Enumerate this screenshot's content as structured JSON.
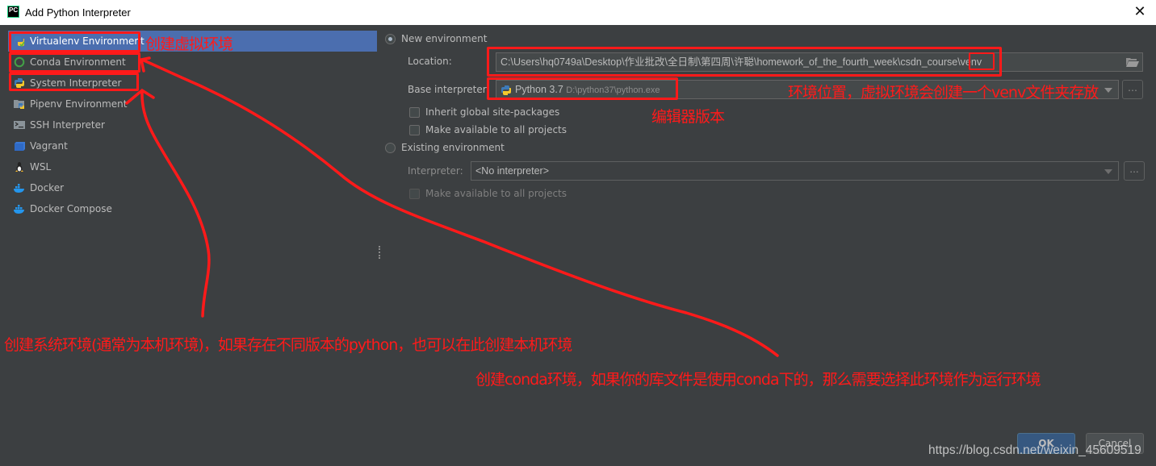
{
  "window": {
    "app_icon": "PC",
    "title": "Add Python Interpreter",
    "close_icon": "close-icon"
  },
  "sidebar": {
    "items": [
      {
        "label": "Virtualenv Environment",
        "icon": "virtualenv-icon",
        "selected": true
      },
      {
        "label": "Conda Environment",
        "icon": "conda-icon"
      },
      {
        "label": "System Interpreter",
        "icon": "python-icon"
      },
      {
        "label": "Pipenv Environment",
        "icon": "pipenv-icon"
      },
      {
        "label": "SSH Interpreter",
        "icon": "terminal-icon"
      },
      {
        "label": "Vagrant",
        "icon": "vagrant-icon"
      },
      {
        "label": "WSL",
        "icon": "linux-icon"
      },
      {
        "label": "Docker",
        "icon": "docker-icon"
      },
      {
        "label": "Docker Compose",
        "icon": "docker-compose-icon"
      }
    ]
  },
  "main": {
    "new_env": {
      "label": "New environment",
      "selected": true,
      "location_label": "Location:",
      "location_value": "C:\\Users\\hq0749a\\Desktop\\作业批改\\全日制\\第四周\\许聪\\homework_of_the_fourth_week\\csdn_course\\venv",
      "base_label": "Base interpreter:",
      "base_version": "Python 3.7",
      "base_path": "D:\\python37\\python.exe",
      "inherit_label": "Inherit global site-packages",
      "inherit_checked": false,
      "available_label": "Make available to all projects",
      "available_checked": false
    },
    "existing_env": {
      "label": "Existing environment",
      "selected": false,
      "interpreter_label": "Interpreter:",
      "interpreter_value": "<No interpreter>",
      "browse_label": "...",
      "available_label": "Make available to all projects",
      "available_checked": false
    }
  },
  "buttons": {
    "ok": "OK",
    "cancel": "Cancel"
  },
  "annotations": {
    "virtualenv": "创建虚拟环境",
    "location": "环境位置，虚拟环境会创建一个venv文件夹存放",
    "base": "编辑器版本",
    "system": "创建系统环境(通常为本机环境)，如果存在不同版本的python，也可以在此创建本机环境",
    "conda": "创建conda环境，如果你的库文件是使用conda下的，那么需要选择此环境作为运行环境"
  },
  "watermark": "https://blog.csdn.net/weixin_45609519",
  "colors": {
    "selection": "#4b6eaf",
    "annotation_red": "#ff1a1a",
    "dialog_bg": "#3c3f41"
  }
}
